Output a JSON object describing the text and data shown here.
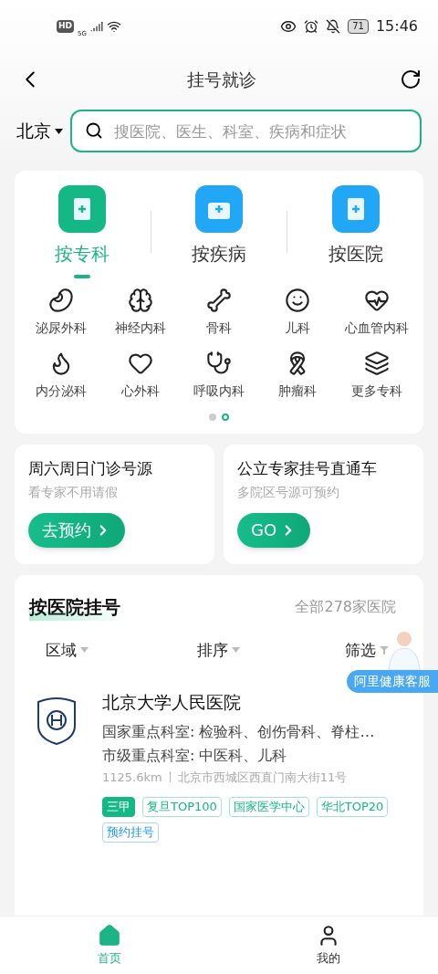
{
  "status_bar": {
    "left": "HD",
    "network": "5G",
    "battery": "71",
    "time": "15:46"
  },
  "header": {
    "title": "挂号就诊"
  },
  "search": {
    "city": "北京",
    "placeholder": "搜医院、医生、科室、疾病和症状"
  },
  "category_tabs": [
    {
      "label": "按专科",
      "selected": true
    },
    {
      "label": "按疾病",
      "selected": false
    },
    {
      "label": "按医院",
      "selected": false
    }
  ],
  "departments": [
    {
      "label": "泌尿外科"
    },
    {
      "label": "神经内科"
    },
    {
      "label": "骨科"
    },
    {
      "label": "儿科"
    },
    {
      "label": "心血管内科"
    },
    {
      "label": "内分泌科"
    },
    {
      "label": "心外科"
    },
    {
      "label": "呼吸内科"
    },
    {
      "label": "肿瘤科"
    },
    {
      "label": "更多专科"
    }
  ],
  "pager": [
    {
      "selected": false
    },
    {
      "selected": true
    }
  ],
  "promos": [
    {
      "title": "周六周日门诊号源",
      "subtitle": "看专家不用请假",
      "button": "去预约"
    },
    {
      "title": "公立专家挂号直通车",
      "subtitle": "多院区号源可预约",
      "button": "GO"
    }
  ],
  "hospital_section": {
    "title": "按医院挂号",
    "count": "全部278家医院",
    "service_badge": "阿里健康客服",
    "filters": [
      {
        "label": "区域",
        "kind": "dropdown"
      },
      {
        "label": "排序",
        "kind": "dropdown"
      },
      {
        "label": "筛选",
        "kind": "filter"
      }
    ],
    "hospitals": [
      {
        "name": "北京大学人民医院",
        "line_1": "国家重点科室: 检验科、创伤骨科、脊柱…",
        "line_2": "市级重点科室: 中医科、儿科",
        "distance": "1125.6km",
        "address": "北京市西城区西直门南大街11号",
        "tags": [
          {
            "label": "三甲",
            "kind": "solid"
          },
          {
            "label": "复旦TOP100",
            "kind": "outline"
          },
          {
            "label": "国家医学中心",
            "kind": "outline"
          },
          {
            "label": "华北TOP20",
            "kind": "outline"
          },
          {
            "label": "预约挂号",
            "kind": "blue"
          }
        ]
      }
    ]
  },
  "bottom_nav": [
    {
      "label": "首页",
      "selected": true
    },
    {
      "label": "我的",
      "selected": false
    }
  ]
}
